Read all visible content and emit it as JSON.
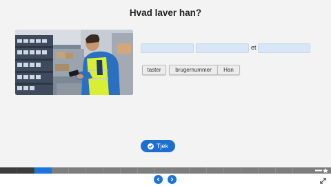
{
  "question": {
    "title": "Hvad laver han?"
  },
  "image": {
    "subject": "worker-with-handheld-scanner"
  },
  "sentence": {
    "connector": "et"
  },
  "choices": [
    "taster",
    "brugernummer",
    "Han"
  ],
  "check_button": {
    "label": "Tjek"
  },
  "progress": {
    "total_segments": 19,
    "completed": 2,
    "current": 3
  },
  "colors": {
    "accent": "#1c6fd1",
    "blank": "#d9e6f6",
    "progress_current": "#1a74de"
  },
  "icons": [
    "check-icon",
    "previous-icon",
    "next-icon",
    "fullscreen-icon",
    "star-icon"
  ]
}
